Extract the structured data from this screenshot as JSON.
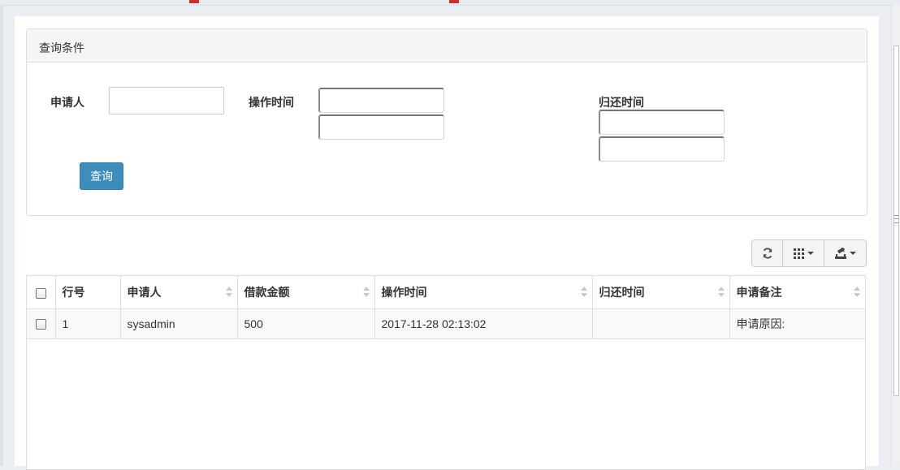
{
  "search_panel": {
    "title": "查询条件",
    "applicant_label": "申请人",
    "applicant_value": "",
    "operation_time_label": "操作时间",
    "operation_time_from": "",
    "operation_time_to": "",
    "return_time_label": "归还时间",
    "return_time_from": "",
    "return_time_to": "",
    "query_button": "查询"
  },
  "toolbar": {
    "buttons": [
      "refresh-icon",
      "columns-icon",
      "export-icon"
    ]
  },
  "table": {
    "columns": [
      "行号",
      "申请人",
      "借款金额",
      "操作时间",
      "归还时间",
      "申请备注"
    ],
    "rows": [
      {
        "no": "1",
        "applicant": "sysadmin",
        "amount": "500",
        "operation_time": "2017-11-28 02:13:02",
        "return_time": "",
        "remark": "申请原因:"
      }
    ]
  },
  "colors": {
    "primary_button": "#3c8dbc",
    "panel_heading": "#f5f5f5",
    "row_striped": "#f9f9f9"
  }
}
